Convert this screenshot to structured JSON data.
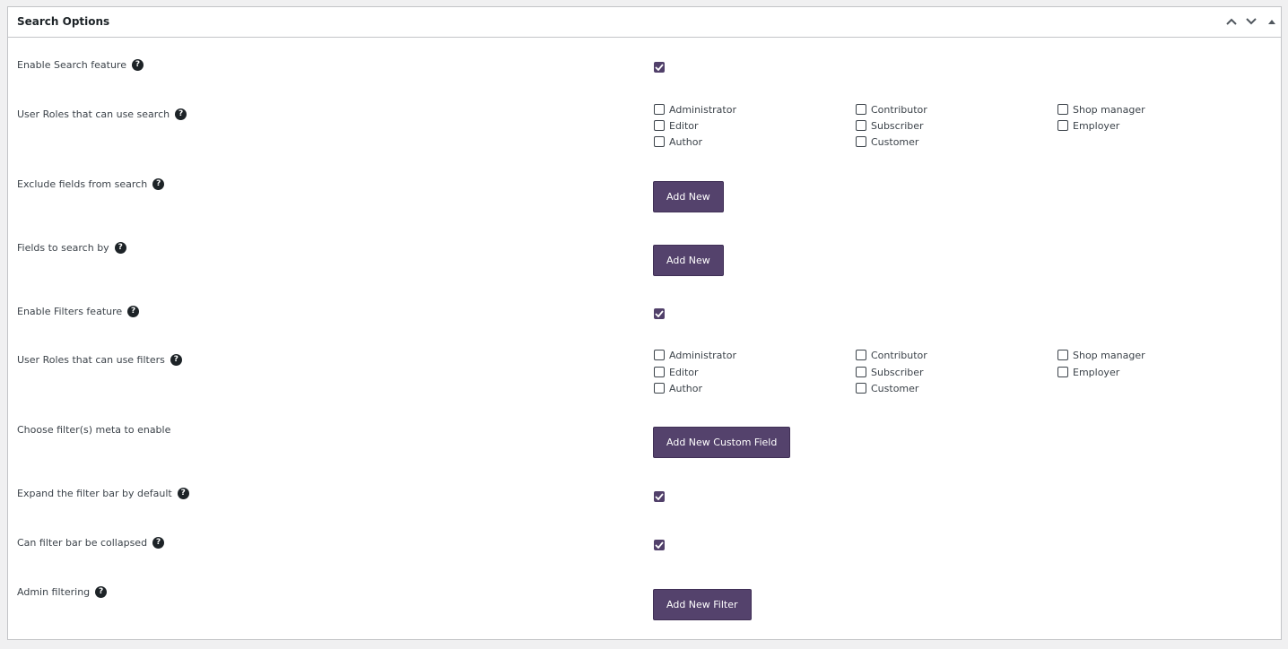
{
  "panel": {
    "title": "Search Options",
    "controls": {
      "move_up_icon": "chevron-up-icon",
      "move_down_icon": "chevron-down-icon",
      "toggle_icon": "triangle-up-icon"
    }
  },
  "colors": {
    "accent": "#54426c",
    "text": "#3c434a",
    "border": "#c3c4c7"
  },
  "rows": {
    "enable_search": {
      "label": "Enable Search feature",
      "checked": true
    },
    "search_roles": {
      "label": "User Roles that can use search",
      "roles": [
        [
          "Administrator",
          "Contributor",
          "Shop manager"
        ],
        [
          "Editor",
          "Subscriber",
          "Employer"
        ],
        [
          "Author",
          "Customer"
        ]
      ]
    },
    "exclude_fields": {
      "label": "Exclude fields from search",
      "button": "Add New"
    },
    "fields_search": {
      "label": "Fields to search by",
      "button": "Add New"
    },
    "enable_filters": {
      "label": "Enable Filters feature",
      "checked": true
    },
    "filter_roles": {
      "label": "User Roles that can use filters",
      "roles": [
        [
          "Administrator",
          "Contributor",
          "Shop manager"
        ],
        [
          "Editor",
          "Subscriber",
          "Employer"
        ],
        [
          "Author",
          "Customer"
        ]
      ]
    },
    "filter_meta": {
      "label": "Choose filter(s) meta to enable",
      "button": "Add New Custom Field"
    },
    "expand_filter": {
      "label": "Expand the filter bar by default",
      "checked": true
    },
    "collapse_filter": {
      "label": "Can filter bar be collapsed",
      "checked": true
    },
    "admin_filtering": {
      "label": "Admin filtering",
      "button": "Add New Filter"
    }
  },
  "help_glyph": "?"
}
